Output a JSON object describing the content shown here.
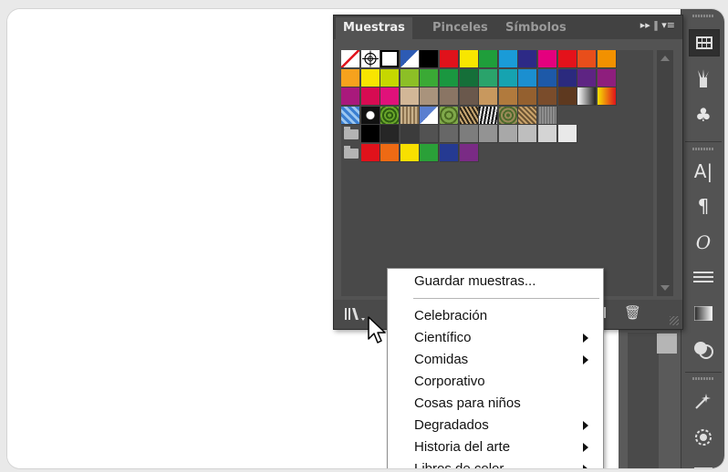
{
  "panel": {
    "tabs": [
      "Muestras",
      "Pinceles",
      "Símbolos"
    ],
    "active_tab": "Muestras",
    "menu_icons": "▸▸ ‖ ▾≡",
    "swatch_rows": [
      [
        "none",
        "registration",
        "#ffffff",
        "#2d5bb4",
        "#000000",
        "#e0121b",
        "#f7e600",
        "#1f9e3b",
        "#1a9bd7",
        "#2d2a86",
        "#e4007e",
        "#e4121b",
        "#e84e1b",
        "#f29100"
      ],
      [
        "#f6a21d",
        "#f8e500",
        "#c6d700",
        "#8cbf26",
        "#3aa935",
        "#1a9740",
        "#156f39",
        "#2aa36b",
        "#16a3b0",
        "#1b8fd0",
        "#1d59a8",
        "#2b2a7e",
        "#5e2483",
        "#8e1e7d"
      ],
      [
        "#a9197c",
        "#d70b52",
        "#e0117a",
        "#d2b797",
        "#a9937c",
        "#8a7564",
        "#6a584c",
        "#c8985e",
        "#b17a3d",
        "#94602f",
        "#7a4c2b",
        "#5e391f",
        "#grad-bw",
        "#grad-yo"
      ],
      [
        "pattern-a",
        "pattern-b",
        "pattern-c",
        "pattern-d",
        "pattern-e",
        "pattern-f",
        "pattern-g",
        "pattern-h",
        "pattern-i",
        "pattern-j",
        "pattern-k"
      ],
      [
        "folder",
        "#000000",
        "#262626",
        "#3c3c3c",
        "#525252",
        "#676767",
        "#7d7d7d",
        "#939393",
        "#a8a8a8",
        "#bebebe",
        "#d4d4d4",
        "#e9e9e9"
      ],
      [
        "folder",
        "#e0121b",
        "#ee6a14",
        "#f8e000",
        "#2aa038",
        "#253a92",
        "#7a2b85"
      ]
    ]
  },
  "menu": {
    "items": [
      {
        "label": "Guardar muestras...",
        "submenu": false
      },
      {
        "label": "Celebración",
        "submenu": false
      },
      {
        "label": "Científico",
        "submenu": true
      },
      {
        "label": "Comidas",
        "submenu": true
      },
      {
        "label": "Corporativo",
        "submenu": false
      },
      {
        "label": "Cosas para niños",
        "submenu": false
      },
      {
        "label": "Degradados",
        "submenu": true
      },
      {
        "label": "Historia del arte",
        "submenu": true
      },
      {
        "label": "Libros de color",
        "submenu": true
      }
    ]
  },
  "toolbar": {
    "icons": [
      "swatches-panel-icon",
      "brushes-icon",
      "symbols-icon",
      "character-icon",
      "paragraph-icon",
      "opentype-icon",
      "stroke-icon",
      "gradient-icon",
      "transparency-icon",
      "magic-wand-icon",
      "appearance-icon"
    ]
  },
  "colors": {
    "panel_bg": "#535353",
    "tab_bar": "#424242",
    "menu_bg": "#ffffff"
  }
}
